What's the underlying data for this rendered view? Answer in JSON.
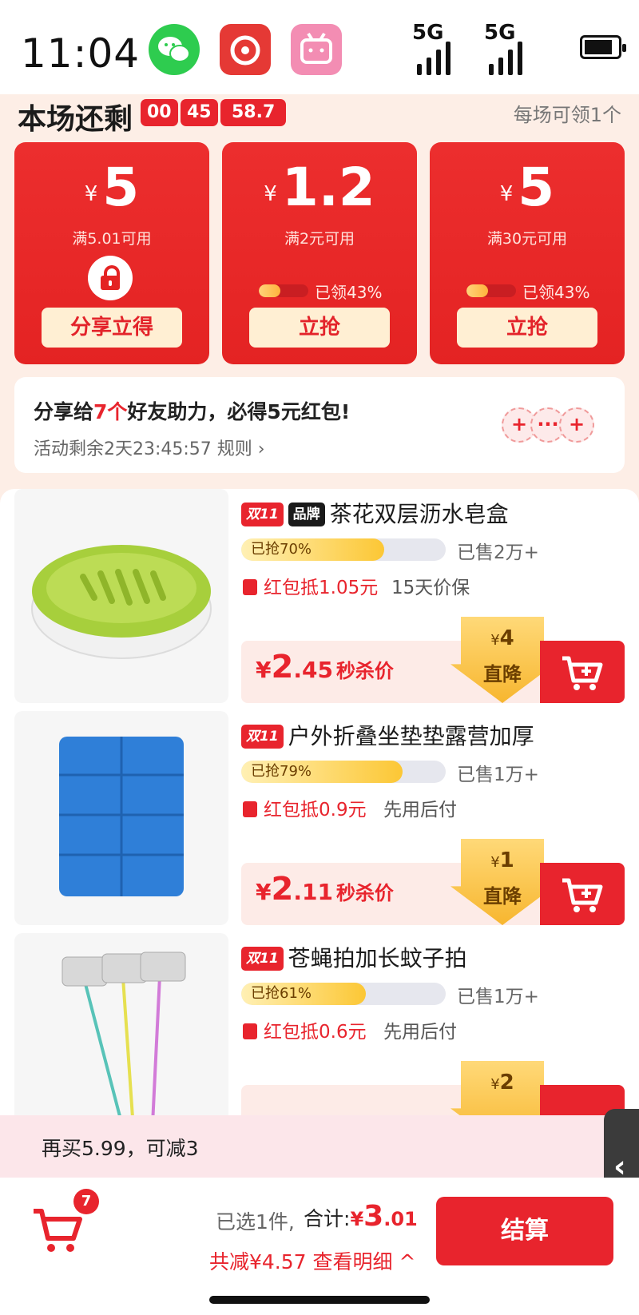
{
  "status_bar": {
    "time": "11:04",
    "network_1": "5G",
    "network_2": "5G"
  },
  "round": {
    "title": "本场还剩",
    "countdown": [
      "00",
      "45",
      "58.7"
    ],
    "per_round": "每场可领1个"
  },
  "coupons": [
    {
      "currency": "¥",
      "amount": "5",
      "condition": "满5.01可用",
      "button": "分享立得"
    },
    {
      "currency": "¥",
      "amount": "1.2",
      "condition": "满2元可用",
      "claimed": "已领43%",
      "claimed_pct": 43,
      "button": "立抢"
    },
    {
      "currency": "¥",
      "amount": "5",
      "condition": "满30元可用",
      "claimed": "已领43%",
      "claimed_pct": 43,
      "button": "立抢"
    }
  ],
  "share": {
    "title_pre": "分享给",
    "title_count": "7个",
    "title_post": "好友助力，必得5元红包!",
    "subtitle": "活动剩余2天23:45:57 规则 ›"
  },
  "products": [
    {
      "tag_event": "双11",
      "tag_brand": "品牌",
      "title": "茶花双层沥水皂盒",
      "progress_label": "已抢70%",
      "progress_pct": 70,
      "sold": "已售2万+",
      "redpacket": "红包抵1.05元",
      "guarantee": "15天价保",
      "price_currency": "¥",
      "price_int": "2",
      "price_dec": ".45",
      "price_label": "秒杀价",
      "drop_currency": "¥",
      "drop_amount": "4",
      "drop_label": "直降"
    },
    {
      "tag_event": "双11",
      "title": "户外折叠坐垫垫露营加厚",
      "progress_label": "已抢79%",
      "progress_pct": 79,
      "sold": "已售1万+",
      "redpacket": "红包抵0.9元",
      "guarantee": "先用后付",
      "price_currency": "¥",
      "price_int": "2",
      "price_dec": ".11",
      "price_label": "秒杀价",
      "drop_currency": "¥",
      "drop_amount": "1",
      "drop_label": "直降"
    },
    {
      "tag_event": "双11",
      "title": "苍蝇拍加长蚊子拍",
      "progress_label": "已抢61%",
      "progress_pct": 61,
      "sold": "已售1万+",
      "redpacket": "红包抵0.6元",
      "guarantee": "先用后付",
      "drop_currency": "¥",
      "drop_amount": "2"
    }
  ],
  "tip": "再买5.99，可减3",
  "footer": {
    "cart_badge": "7",
    "selected": "已选1件,",
    "total_label": "合计:",
    "total_currency": "¥",
    "total_int": "3",
    "total_dec": ".01",
    "savings": "共减¥4.57 查看明细 ^",
    "checkout": "结算"
  },
  "side_handle": "‹",
  "colors": {
    "accent": "#e8242d",
    "gold": "#fcc735",
    "background": "#fdeee6"
  }
}
